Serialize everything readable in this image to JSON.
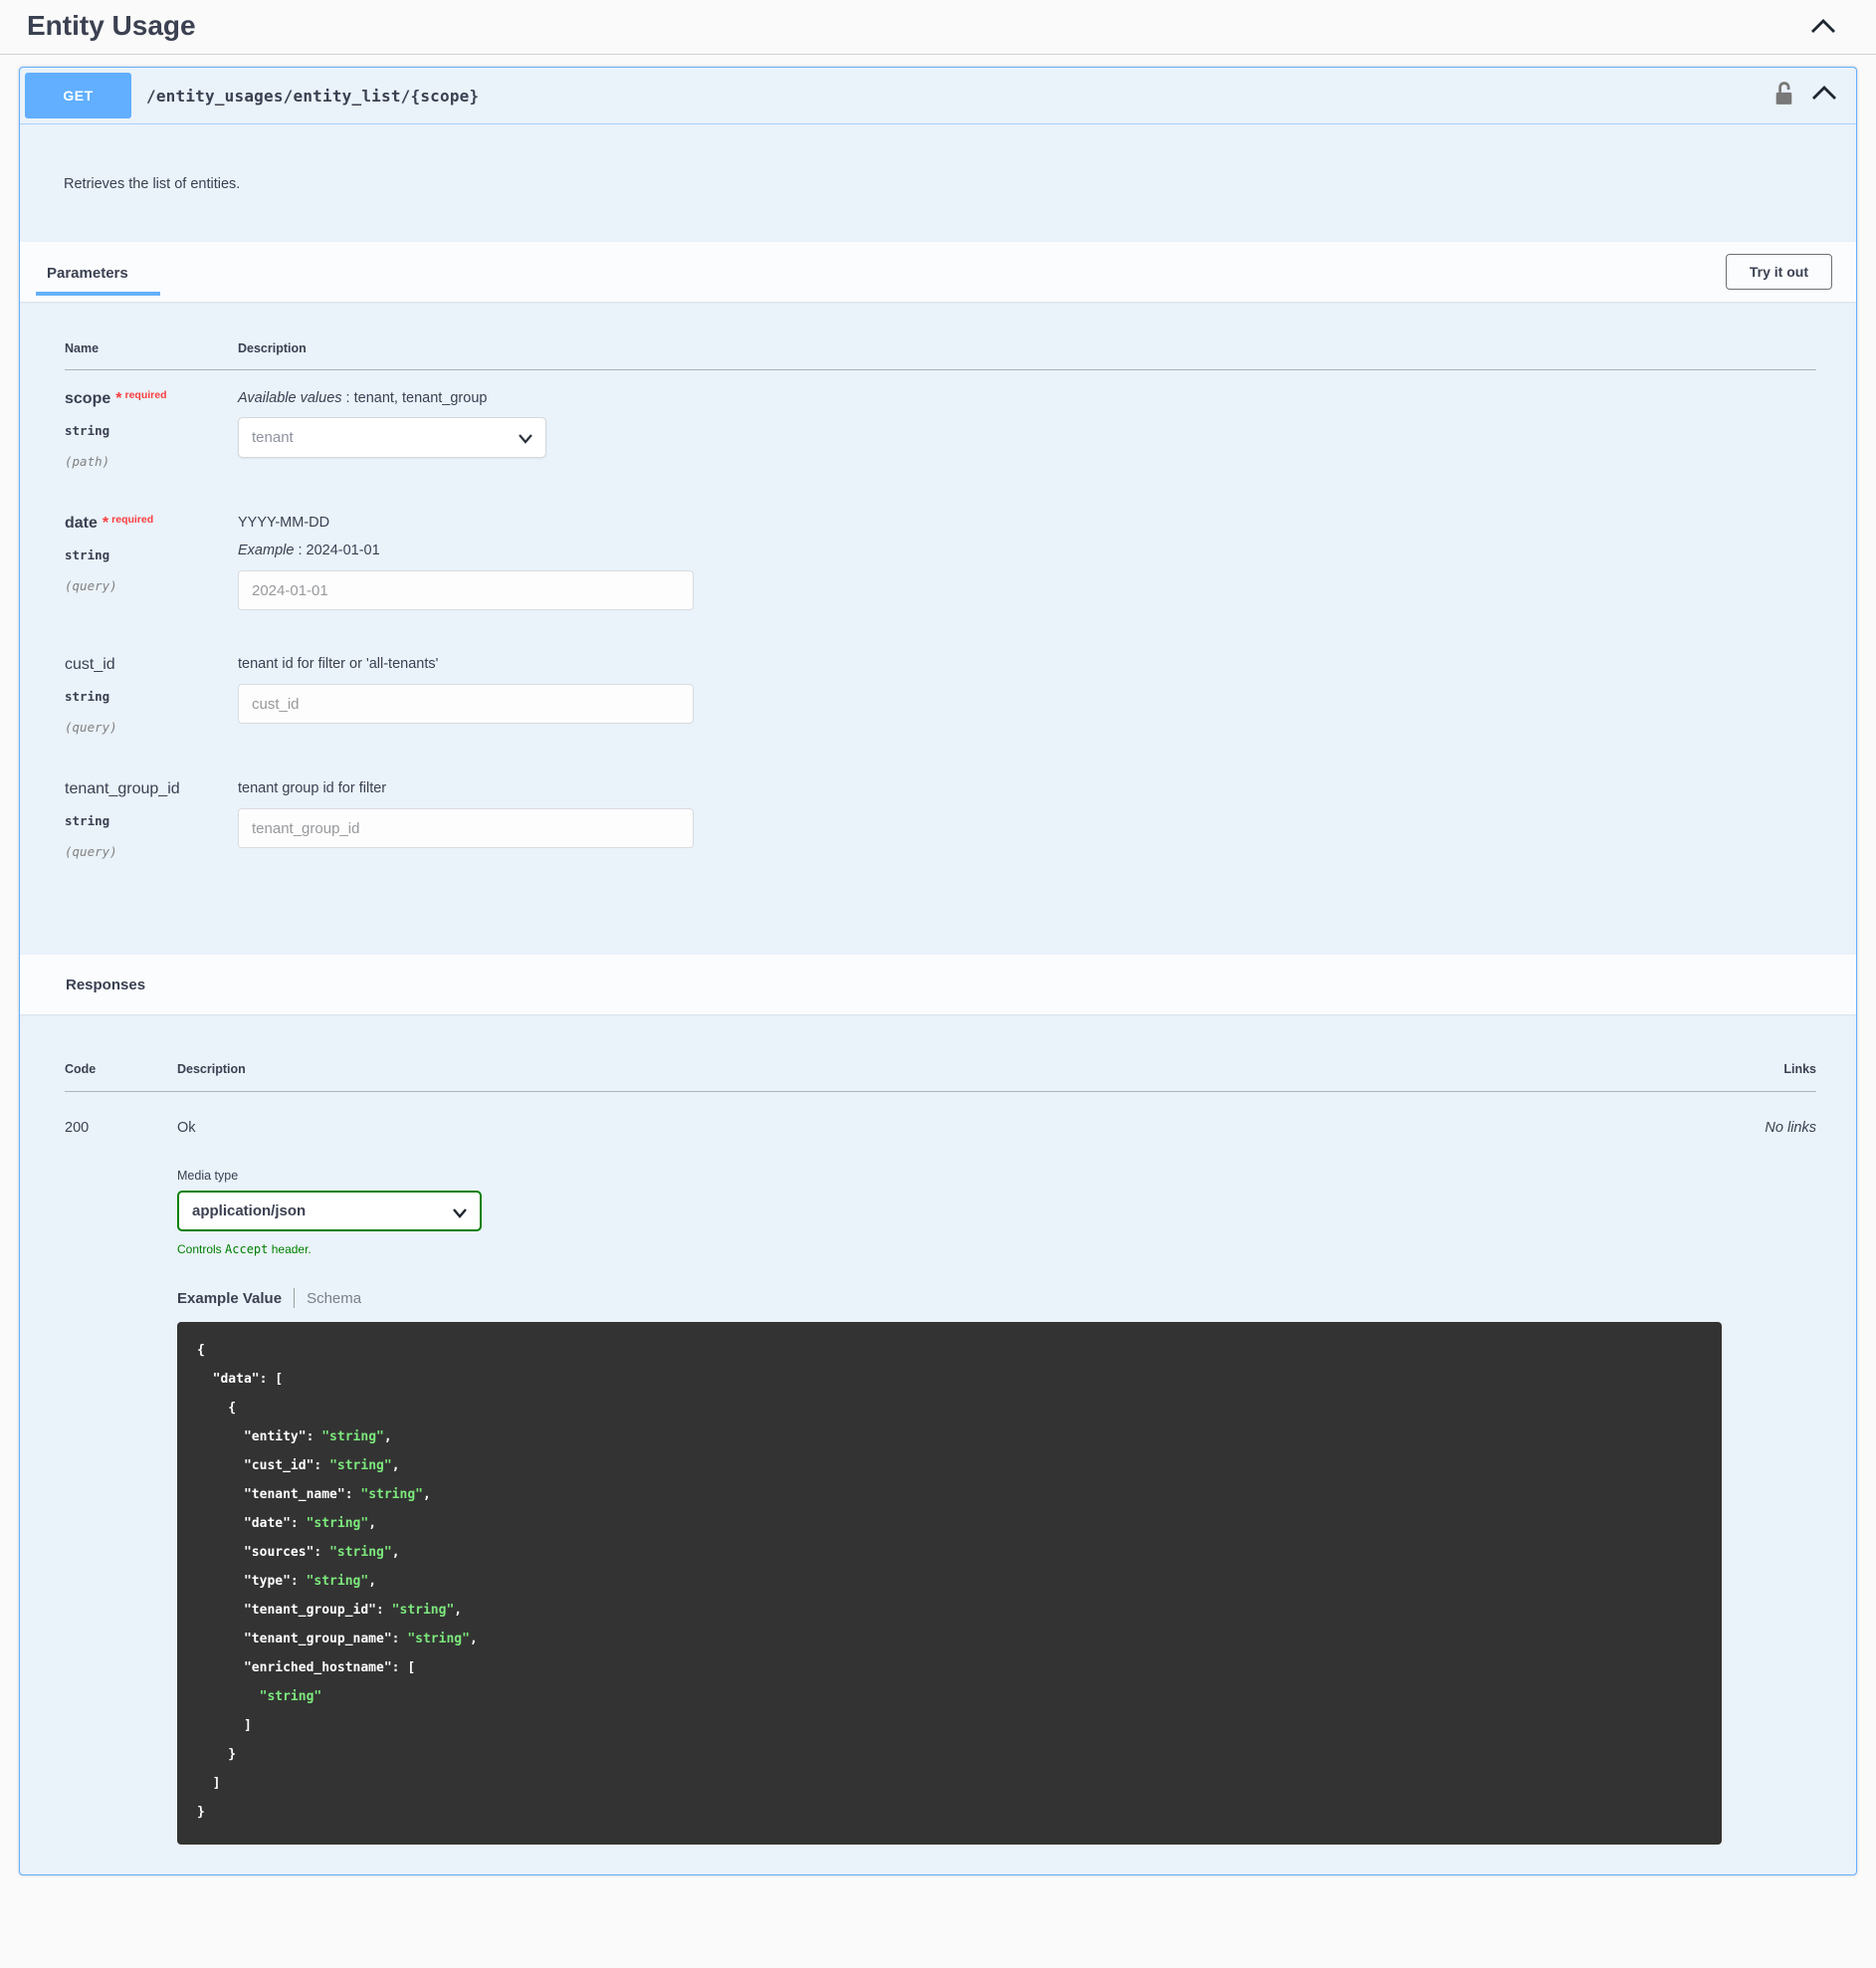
{
  "tag": {
    "title": "Entity Usage"
  },
  "operation": {
    "method": "GET",
    "path": "/entity_usages/entity_list/{scope}",
    "description": "Retrieves the list of entities."
  },
  "icons": {
    "tag_collapse": "chevron-up-icon",
    "operation_collapse": "chevron-up-icon",
    "auth": "unlock-icon",
    "select_caret": "chevron-down-icon"
  },
  "colors": {
    "accent_blue": "#61affe",
    "block_background": "#eaf2fa",
    "required_red": "#f93e3e",
    "success_green": "#008000",
    "code_background": "#333333",
    "code_string_green": "#7ce87c"
  },
  "parameters": {
    "title": "Parameters",
    "try_it_out_label": "Try it out",
    "col_name": "Name",
    "col_description": "Description",
    "rows": [
      {
        "name": "scope",
        "required_star": "*",
        "required_label": "required",
        "type": "string",
        "in": "(path)",
        "available_label": "Available values",
        "available_rest": " : tenant, tenant_group",
        "select_value": "tenant"
      },
      {
        "name": "date",
        "required_star": "*",
        "required_label": "required",
        "type": "string",
        "in": "(query)",
        "description": "YYYY-MM-DD",
        "example_label": "Example",
        "example_rest": " : 2024-01-01",
        "placeholder": "2024-01-01"
      },
      {
        "name": "cust_id",
        "type": "string",
        "in": "(query)",
        "description": "tenant id for filter or 'all-tenants'",
        "placeholder": "cust_id"
      },
      {
        "name": "tenant_group_id",
        "type": "string",
        "in": "(query)",
        "description": "tenant group id for filter",
        "placeholder": "tenant_group_id"
      }
    ]
  },
  "responses": {
    "title": "Responses",
    "col_code": "Code",
    "col_description": "Description",
    "col_links": "Links",
    "row": {
      "code": "200",
      "description": "Ok",
      "links": "No links"
    },
    "media_type_label": "Media type",
    "media_type_value": "application/json",
    "controls_note_prefix": "Controls ",
    "controls_note_code": "Accept",
    "controls_note_suffix": " header.",
    "tabs": {
      "example": "Example Value",
      "schema": "Schema"
    },
    "example_lines": [
      [
        {
          "t": "{"
        }
      ],
      [
        {
          "t": "  \"data\": ["
        }
      ],
      [
        {
          "t": "    {"
        }
      ],
      [
        {
          "t": "      \"entity\": "
        },
        {
          "t": "\"string\"",
          "g": true
        },
        {
          "t": ","
        }
      ],
      [
        {
          "t": "      \"cust_id\": "
        },
        {
          "t": "\"string\"",
          "g": true
        },
        {
          "t": ","
        }
      ],
      [
        {
          "t": "      \"tenant_name\": "
        },
        {
          "t": "\"string\"",
          "g": true
        },
        {
          "t": ","
        }
      ],
      [
        {
          "t": "      \"date\": "
        },
        {
          "t": "\"string\"",
          "g": true
        },
        {
          "t": ","
        }
      ],
      [
        {
          "t": "      \"sources\": "
        },
        {
          "t": "\"string\"",
          "g": true
        },
        {
          "t": ","
        }
      ],
      [
        {
          "t": "      \"type\": "
        },
        {
          "t": "\"string\"",
          "g": true
        },
        {
          "t": ","
        }
      ],
      [
        {
          "t": "      \"tenant_group_id\": "
        },
        {
          "t": "\"string\"",
          "g": true
        },
        {
          "t": ","
        }
      ],
      [
        {
          "t": "      \"tenant_group_name\": "
        },
        {
          "t": "\"string\"",
          "g": true
        },
        {
          "t": ","
        }
      ],
      [
        {
          "t": "      \"enriched_hostname\": ["
        }
      ],
      [
        {
          "t": "        "
        },
        {
          "t": "\"string\"",
          "g": true
        }
      ],
      [
        {
          "t": "      ]"
        }
      ],
      [
        {
          "t": "    }"
        }
      ],
      [
        {
          "t": "  ]"
        }
      ],
      [
        {
          "t": "}"
        }
      ]
    ]
  }
}
